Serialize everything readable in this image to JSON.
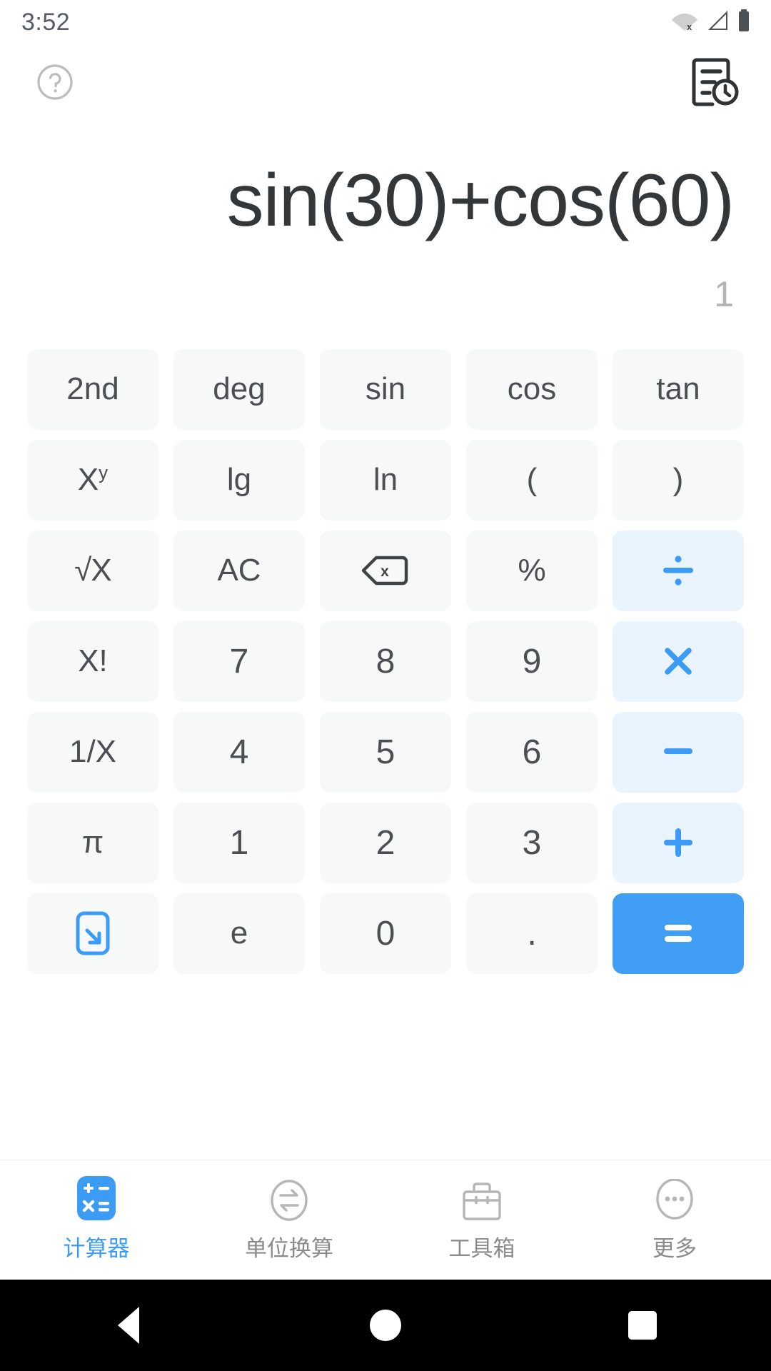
{
  "status_bar": {
    "time": "3:52",
    "icons": [
      "wifi-off-icon",
      "cellular-signal-icon",
      "battery-full-icon"
    ]
  },
  "top_actions": {
    "help_icon": "help-circle-icon",
    "history_icon": "history-document-icon"
  },
  "display": {
    "expression": "sin(30)+cos(60)",
    "result": "1"
  },
  "keypad": {
    "rows": [
      [
        {
          "label": "2nd",
          "type": "fn",
          "name": "key-2nd"
        },
        {
          "label": "deg",
          "type": "fn",
          "name": "key-deg"
        },
        {
          "label": "sin",
          "type": "fn",
          "name": "key-sin"
        },
        {
          "label": "cos",
          "type": "fn",
          "name": "key-cos"
        },
        {
          "label": "tan",
          "type": "fn",
          "name": "key-tan"
        }
      ],
      [
        {
          "label": "X",
          "sup": "y",
          "type": "fn",
          "name": "key-power"
        },
        {
          "label": "lg",
          "type": "fn",
          "name": "key-lg"
        },
        {
          "label": "ln",
          "type": "fn",
          "name": "key-ln"
        },
        {
          "label": "(",
          "type": "fn",
          "name": "key-open-paren"
        },
        {
          "label": ")",
          "type": "fn",
          "name": "key-close-paren"
        }
      ],
      [
        {
          "label": "√X",
          "type": "fn",
          "name": "key-sqrt"
        },
        {
          "label": "AC",
          "type": "fn",
          "name": "key-all-clear"
        },
        {
          "label": "",
          "type": "fn",
          "name": "key-backspace",
          "icon": "backspace-icon"
        },
        {
          "label": "%",
          "type": "fn",
          "name": "key-percent"
        },
        {
          "label": "÷",
          "type": "op",
          "name": "key-divide",
          "icon": "divide-icon"
        }
      ],
      [
        {
          "label": "X!",
          "type": "fn",
          "name": "key-factorial"
        },
        {
          "label": "7",
          "type": "num",
          "name": "key-7"
        },
        {
          "label": "8",
          "type": "num",
          "name": "key-8"
        },
        {
          "label": "9",
          "type": "num",
          "name": "key-9"
        },
        {
          "label": "×",
          "type": "op",
          "name": "key-multiply",
          "icon": "multiply-icon"
        }
      ],
      [
        {
          "label": "1/X",
          "type": "fn",
          "name": "key-reciprocal"
        },
        {
          "label": "4",
          "type": "num",
          "name": "key-4"
        },
        {
          "label": "5",
          "type": "num",
          "name": "key-5"
        },
        {
          "label": "6",
          "type": "num",
          "name": "key-6"
        },
        {
          "label": "−",
          "type": "op",
          "name": "key-minus",
          "icon": "minus-icon"
        }
      ],
      [
        {
          "label": "π",
          "type": "fn",
          "name": "key-pi"
        },
        {
          "label": "1",
          "type": "num",
          "name": "key-1"
        },
        {
          "label": "2",
          "type": "num",
          "name": "key-2"
        },
        {
          "label": "3",
          "type": "num",
          "name": "key-3"
        },
        {
          "label": "+",
          "type": "op",
          "name": "key-plus",
          "icon": "plus-icon"
        }
      ],
      [
        {
          "label": "",
          "type": "fn",
          "name": "key-collapse-keyboard",
          "icon": "collapse-keyboard-icon"
        },
        {
          "label": "e",
          "type": "fn",
          "name": "key-e"
        },
        {
          "label": "0",
          "type": "num",
          "name": "key-0"
        },
        {
          "label": ".",
          "type": "num",
          "name": "key-decimal"
        },
        {
          "label": "=",
          "type": "equals",
          "name": "key-equals",
          "icon": "equals-icon"
        }
      ]
    ]
  },
  "bottom_nav": {
    "items": [
      {
        "label": "计算器",
        "icon": "calculator-icon",
        "active": true
      },
      {
        "label": "单位换算",
        "icon": "unit-convert-icon",
        "active": false
      },
      {
        "label": "工具箱",
        "icon": "toolbox-icon",
        "active": false
      },
      {
        "label": "更多",
        "icon": "more-dots-icon",
        "active": false
      }
    ]
  },
  "system_nav": {
    "back": "back-triangle-icon",
    "home": "home-circle-icon",
    "recents": "recents-square-icon"
  },
  "colors": {
    "accent": "#3c9cf5",
    "equals_bg": "#409ef5",
    "op_bg": "#eaf4fe",
    "key_bg": "#f7f8f8",
    "text": "#4a4f54",
    "result_text": "#b4b4b4"
  }
}
